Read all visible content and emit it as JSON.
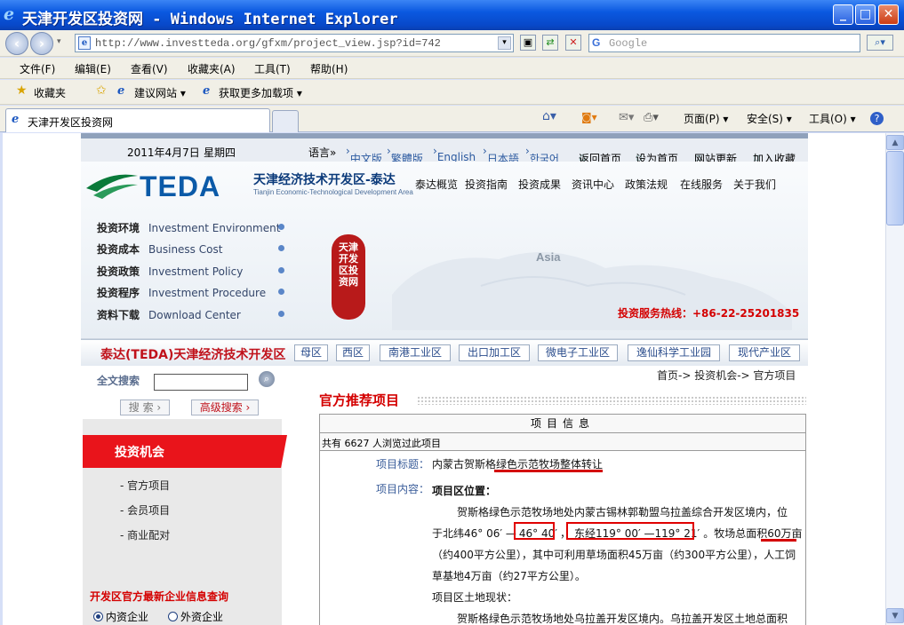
{
  "window": {
    "title": "天津开发区投资网 - Windows Internet Explorer",
    "minimize": "_",
    "maximize": "□",
    "close": "✕"
  },
  "address": {
    "url": "http://www.investteda.org/gfxm/project_view.jsp?id=742",
    "search_placeholder": "Google"
  },
  "menu": [
    "文件(F)",
    "编辑(E)",
    "查看(V)",
    "收藏夹(A)",
    "工具(T)",
    "帮助(H)"
  ],
  "favorites": {
    "label": "收藏夹",
    "items": [
      "建议网站 ▾",
      "获取更多加载项 ▾"
    ]
  },
  "tab": {
    "title": "天津开发区投资网",
    "tools": [
      "页面(P) ▾",
      "安全(S) ▾",
      "工具(O) ▾"
    ]
  },
  "site": {
    "date": "2011年4月7日",
    "weekday": "星期四",
    "lang_label": "语言»",
    "languages": [
      "中文版",
      "繁體版",
      "English",
      "日本語",
      "한국어"
    ],
    "top_links": [
      "返回首页",
      "设为首页",
      "网站更新",
      "加入收藏"
    ],
    "logo_text": "TEDA",
    "logo_cn": "天津经济技术开发区-泰达",
    "logo_en": "Tianjin Economic-Technological Development Area",
    "main_nav": [
      "泰达概览",
      "投资指南",
      "投资成果",
      "资讯中心",
      "政策法规",
      "在线服务",
      "关于我们"
    ],
    "left_menu": [
      {
        "cn": "投资环境",
        "en": "Investment Environment"
      },
      {
        "cn": "投资成本",
        "en": "Business Cost"
      },
      {
        "cn": "投资政策",
        "en": "Investment Policy"
      },
      {
        "cn": "投资程序",
        "en": "Investment Procedure"
      },
      {
        "cn": "资料下载",
        "en": "Download Center"
      }
    ],
    "seal_text": "天津开发区投资网",
    "map_label": "Asia",
    "hotline": "投资服务热线：+86-22-25201835",
    "zone_title": "泰达(TEDA)天津经济技术开发区",
    "zones": [
      "母区",
      "西区",
      "南港工业区",
      "出口加工区",
      "微电子工业区",
      "逸仙科学工业园",
      "现代产业区"
    ]
  },
  "sidebar": {
    "search_label": "全文搜索",
    "search_value": "",
    "search_btn": "搜 索 ›",
    "adv_btn": "高级搜索 ›",
    "section_title": "投资机会",
    "sub_items": [
      "- 官方项目",
      "- 会员项目",
      "- 商业配对"
    ],
    "query_title": "开发区官方最新企业信息查询",
    "radios": [
      "内资企业",
      "外资企业"
    ]
  },
  "content": {
    "breadcrumb": "首页-> 投资机会-> 官方项目",
    "title": "官方推荐项目",
    "table_header": "项目信息",
    "views": "共有  6627  人浏览过此项目",
    "project_title_label": "项目标题：",
    "project_title": "内蒙古贺斯格绿色示范牧场整体转让",
    "project_content_label": "项目内容：",
    "section1": "项目区位置：",
    "line1": "贺斯格绿色示范牧场地处内蒙古锡林郭勒盟乌拉盖综合开发区境内，位",
    "line2_a": "于北纬46° 06′ —",
    "line2_b": "46° 40′",
    "line2_c": "，",
    "line2_d": "东经119° 00′ —119° 21′",
    "line2_e": "。牧场总面积",
    "line2_f": "60万亩",
    "line3": "（约400平方公里），其中可利用草场面积45万亩（约300平方公里），人工饲",
    "line4": "草基地4万亩（约27平方公里）。",
    "section2": "项目区土地现状：",
    "line5": "贺斯格绿色示范牧场地处乌拉盖开发区境内。乌拉盖开发区土地总面积"
  }
}
